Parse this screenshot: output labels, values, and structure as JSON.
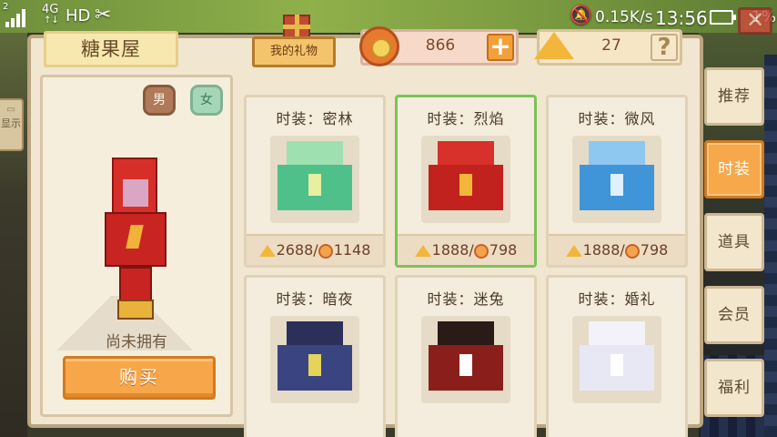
{
  "status_bar": {
    "sim_slot": "2",
    "network": "4G",
    "hd": "HD",
    "speed": "0.15K/s",
    "time": "13:56",
    "battery": "1%"
  },
  "header": {
    "shop_title": "糖果屋",
    "gift_label": "我的礼物",
    "coins": "866",
    "cheese": "27",
    "plus": "+",
    "help": "?",
    "close": "✕"
  },
  "preview": {
    "gender_male": "男",
    "gender_female": "女",
    "status": "尚未拥有",
    "buy_label": "购买",
    "side_toggle": "显示"
  },
  "items": [
    {
      "title": "时装：密林",
      "cheese_price": "2688",
      "coin_price": "1148",
      "colors": {
        "top": "#9fe0b0",
        "body": "#4fc08a",
        "accent": "#e6f0a0"
      },
      "selected": false
    },
    {
      "title": "时装：烈焰",
      "cheese_price": "1888",
      "coin_price": "798",
      "colors": {
        "top": "#d8302a",
        "body": "#c1221d",
        "accent": "#f2b63a"
      },
      "selected": true
    },
    {
      "title": "时装：微风",
      "cheese_price": "1888",
      "coin_price": "798",
      "colors": {
        "top": "#8ec7f0",
        "body": "#3f95d8",
        "accent": "#dff0ff"
      },
      "selected": false
    },
    {
      "title": "时装：暗夜",
      "cheese_price": "",
      "coin_price": "",
      "colors": {
        "top": "#2b2f5a",
        "body": "#3a4480",
        "accent": "#e5d35a"
      },
      "selected": false
    },
    {
      "title": "时装：迷兔",
      "cheese_price": "",
      "coin_price": "",
      "colors": {
        "top": "#2a1a18",
        "body": "#8a1e1a",
        "accent": "#ffffff"
      },
      "selected": false
    },
    {
      "title": "时装：婚礼",
      "cheese_price": "",
      "coin_price": "",
      "colors": {
        "top": "#f2f2f8",
        "body": "#e8e8f4",
        "accent": "#ffffff"
      },
      "selected": false
    }
  ],
  "nav_tabs": [
    {
      "label": "推荐",
      "active": false
    },
    {
      "label": "时装",
      "active": true
    },
    {
      "label": "道具",
      "active": false
    },
    {
      "label": "会员",
      "active": false
    },
    {
      "label": "福利",
      "active": false
    }
  ]
}
